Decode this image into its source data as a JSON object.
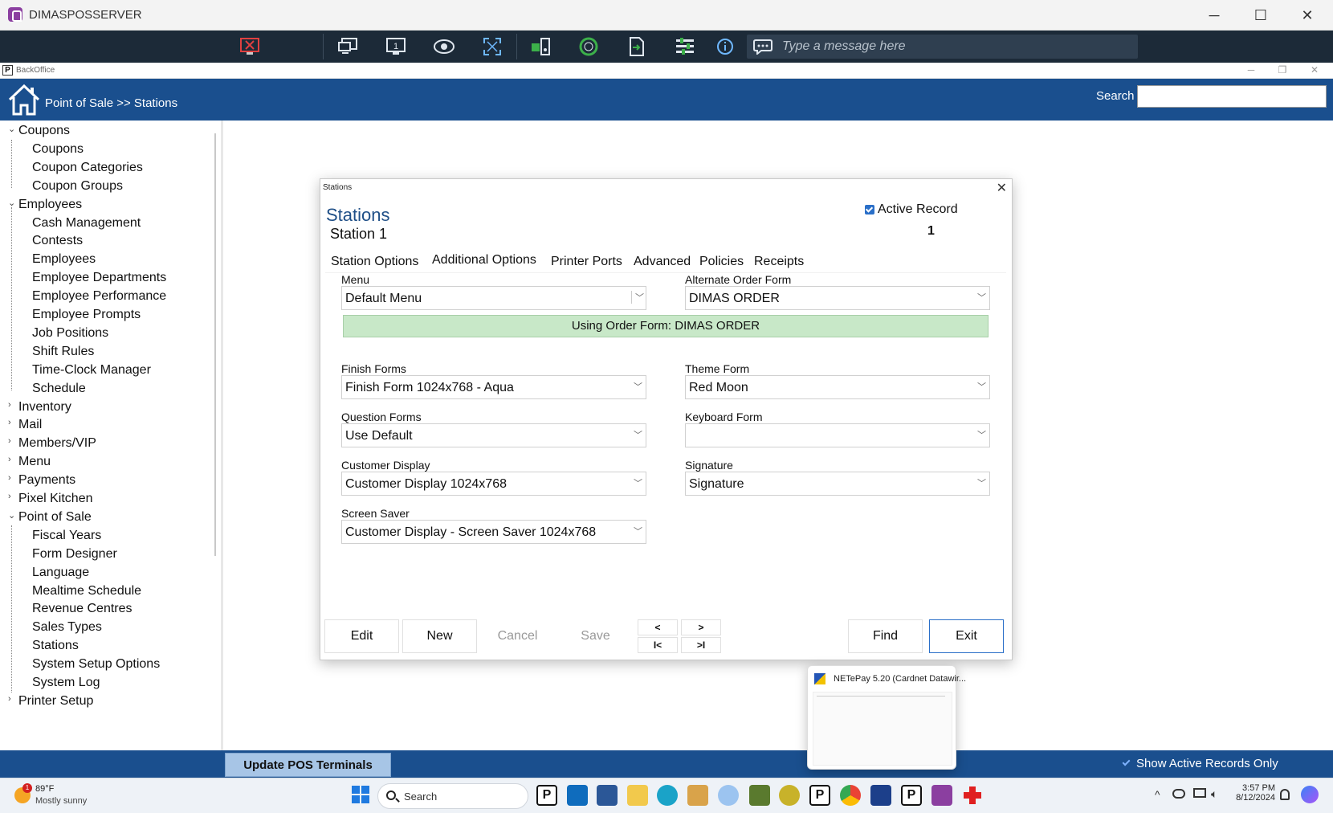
{
  "window": {
    "title": "DIMASPOSSERVER"
  },
  "remote_toolbar": {
    "message_placeholder": "Type a message here",
    "icons": [
      "disconnect-icon",
      "remote-monitor-icon",
      "monitor-1-icon",
      "view-icon",
      "fullscreen-icon",
      "transfer-icon",
      "record-icon",
      "file-transfer-icon",
      "manage-icon",
      "info-icon",
      "chat-icon"
    ]
  },
  "backoffice": {
    "title": "BackOffice"
  },
  "header": {
    "breadcrumb": "Point of Sale >> Stations",
    "search_label": "Search",
    "search_value": ""
  },
  "sidebar": {
    "items": [
      {
        "label": "Coupons",
        "level": 0,
        "expanded": true
      },
      {
        "label": "Coupons",
        "level": 1
      },
      {
        "label": "Coupon Categories",
        "level": 1
      },
      {
        "label": "Coupon Groups",
        "level": 1
      },
      {
        "label": "Employees",
        "level": 0,
        "expanded": true
      },
      {
        "label": "Cash Management",
        "level": 1
      },
      {
        "label": "Contests",
        "level": 1
      },
      {
        "label": "Employees",
        "level": 1
      },
      {
        "label": "Employee Departments",
        "level": 1
      },
      {
        "label": "Employee Performance",
        "level": 1
      },
      {
        "label": "Employee Prompts",
        "level": 1
      },
      {
        "label": "Job Positions",
        "level": 1
      },
      {
        "label": "Shift Rules",
        "level": 1
      },
      {
        "label": "Time-Clock Manager",
        "level": 1
      },
      {
        "label": "Schedule",
        "level": 1
      },
      {
        "label": "Inventory",
        "level": 0,
        "expanded": false
      },
      {
        "label": "Mail",
        "level": 0,
        "expanded": false
      },
      {
        "label": "Members/VIP",
        "level": 0,
        "expanded": false
      },
      {
        "label": "Menu",
        "level": 0,
        "expanded": false
      },
      {
        "label": "Payments",
        "level": 0,
        "expanded": false
      },
      {
        "label": "Pixel Kitchen",
        "level": 0,
        "expanded": false
      },
      {
        "label": "Point of Sale",
        "level": 0,
        "expanded": true
      },
      {
        "label": "Fiscal Years",
        "level": 1
      },
      {
        "label": "Form Designer",
        "level": 1
      },
      {
        "label": "Language",
        "level": 1
      },
      {
        "label": "Mealtime Schedule",
        "level": 1
      },
      {
        "label": "Revenue Centres",
        "level": 1
      },
      {
        "label": "Sales Types",
        "level": 1
      },
      {
        "label": "Stations",
        "level": 1
      },
      {
        "label": "System Setup Options",
        "level": 1
      },
      {
        "label": "System Log",
        "level": 1
      },
      {
        "label": "Printer Setup",
        "level": 0,
        "expanded": false
      }
    ]
  },
  "dialog": {
    "window_title": "Stations",
    "heading": "Stations",
    "record_name": "Station 1",
    "active_record_label": "Active Record",
    "active_record_checked": true,
    "record_number": "1",
    "tabs": [
      "Station Options",
      "Additional Options",
      "Printer Ports",
      "Advanced",
      "Policies",
      "Receipts"
    ],
    "active_tab": "Additional Options",
    "fields": {
      "menu": {
        "label": "Menu",
        "value": "Default Menu"
      },
      "alternate_order_form": {
        "label": "Alternate Order Form",
        "value": "DIMAS ORDER"
      },
      "using_banner": "Using Order Form: DIMAS ORDER",
      "finish_forms": {
        "label": "Finish Forms",
        "value": "Finish Form 1024x768 - Aqua"
      },
      "theme_form": {
        "label": "Theme Form",
        "value": "Red Moon"
      },
      "question_forms": {
        "label": "Question Forms",
        "value": "Use Default"
      },
      "keyboard_form": {
        "label": "Keyboard Form",
        "value": ""
      },
      "customer_display": {
        "label": "Customer Display",
        "value": "Customer Display 1024x768"
      },
      "signature": {
        "label": "Signature",
        "value": "Signature"
      },
      "screen_saver": {
        "label": "Screen Saver",
        "value": "Customer Display - Screen Saver 1024x768"
      }
    },
    "buttons": {
      "edit": "Edit",
      "new": "New",
      "cancel": "Cancel",
      "save": "Save",
      "prev": "<",
      "next": ">",
      "first": "I<",
      "last": ">I",
      "find": "Find",
      "exit": "Exit"
    }
  },
  "bottom_bar": {
    "update_button": "Update POS Terminals",
    "show_active_label": "Show Active Records Only"
  },
  "popup": {
    "title": "NETePay 5.20 (Cardnet Datawir..."
  },
  "taskbar": {
    "weather_temp": "89°F",
    "weather_cond": "Mostly sunny",
    "weather_badge": "1",
    "search_label": "Search",
    "time": "3:57 PM",
    "date": "8/12/2024"
  },
  "colors": {
    "header_blue": "#1a4f8e",
    "toolbar_dark": "#1c2a38",
    "banner_green": "#c8e8c8",
    "accent": "#2a6fc8"
  }
}
